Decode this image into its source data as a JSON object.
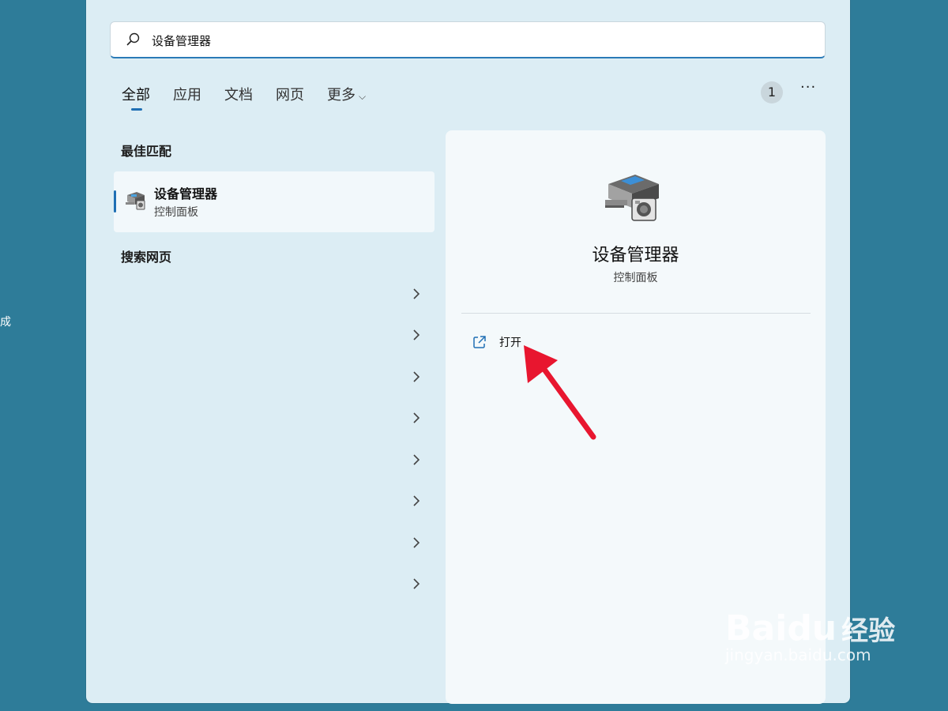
{
  "desktop": {
    "edge_text": "成"
  },
  "search": {
    "value": "设备管理器",
    "placeholder": ""
  },
  "tabs": [
    {
      "label": "全部",
      "active": true
    },
    {
      "label": "应用"
    },
    {
      "label": "文档"
    },
    {
      "label": "网页"
    },
    {
      "label": "更多"
    }
  ],
  "header": {
    "badge": "1",
    "more": "···"
  },
  "best_match": {
    "title": "最佳匹配",
    "item": {
      "name": "设备管理器",
      "category": "控制面板",
      "icon": "device-manager-icon"
    }
  },
  "web_search": {
    "title": "搜索网页",
    "row_count": 8
  },
  "detail": {
    "name": "设备管理器",
    "category": "控制面板",
    "icon": "device-manager-icon",
    "actions": [
      {
        "label": "打开",
        "icon": "open-external-icon"
      }
    ]
  },
  "watermark": {
    "brand": "Bai",
    "brand2": "du",
    "cn": "经验",
    "url": "jingyan.baidu.com"
  },
  "colors": {
    "accent": "#1f6fb4",
    "annotation_arrow": "#e8162f",
    "desktop": "#2e7c99"
  }
}
